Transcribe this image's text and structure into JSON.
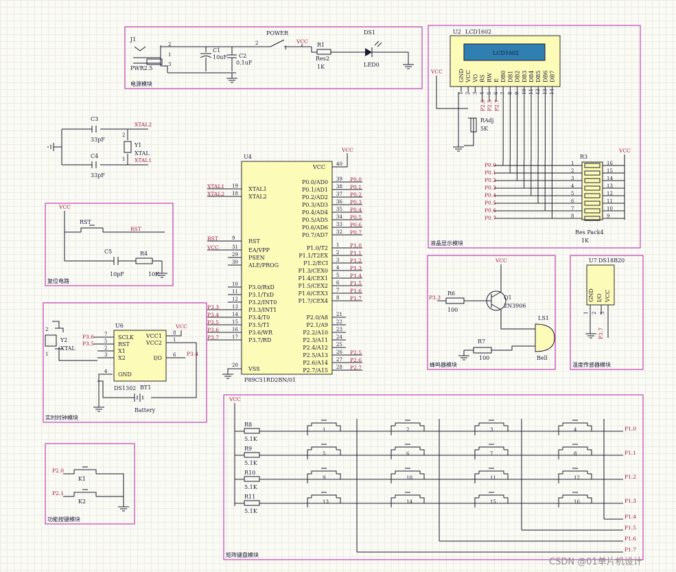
{
  "modules": {
    "power": "电源模块",
    "lcd": "液晶显示模块",
    "reset": "复位电路",
    "buzzer": "蜂鸣器模块",
    "temp": "温度传感器模块",
    "rtc": "实时时钟模块",
    "func_keys": "功能按键模块",
    "matrix_keys": "矩阵键盘模块"
  },
  "power": {
    "j1": "J1",
    "pwr": "PWR2.5",
    "c1": "C1",
    "c1v": "10uF",
    "c2": "C2",
    "c2v": "0.1uF",
    "switch": "POWER",
    "vcc": "VCC",
    "r1": "R1",
    "r1t": "Res2",
    "r1v": "1K",
    "ds1": "DS1",
    "led": "LED0",
    "p1": "1",
    "p2": "2",
    "p3": "3",
    "sw1": "1",
    "sw2": "2"
  },
  "crystal": {
    "c3": "C3",
    "c3v": "33pF",
    "c4": "C4",
    "c4v": "33pF",
    "y1": "Y1",
    "xtal": "XTAL",
    "xtal2": "XTAL2",
    "xtal1": "XTAL1",
    "p1": "1",
    "p2": "2"
  },
  "reset": {
    "vcc": "VCC",
    "rst": "RST",
    "rstnet": "RST",
    "c5": "C5",
    "c5v": "10pF",
    "r4": "R4",
    "r4v": "10K"
  },
  "mcu": {
    "ref": "U4",
    "part": "P89C51RD2BN/01",
    "vcc": "VCC",
    "vss": "VSS",
    "p40": "40",
    "p20": "20",
    "left_pins": [
      {
        "n": "19",
        "name": "XTAL1",
        "net": "XTAL1"
      },
      {
        "n": "18",
        "name": "XTAL2",
        "net": "XTAL2"
      },
      {
        "n": "9",
        "name": "RST",
        "net": "RST"
      },
      {
        "n": "31",
        "name": "EA/VPP",
        "net": "VCC"
      },
      {
        "n": "29",
        "name": "PSEN",
        "net": ""
      },
      {
        "n": "30",
        "name": "ALE/PROG",
        "net": ""
      },
      {
        "n": "10",
        "name": "P3.0/RxD",
        "net": ""
      },
      {
        "n": "11",
        "name": "P3.1/TxD",
        "net": ""
      },
      {
        "n": "12",
        "name": "P3.2/INT0",
        "net": ""
      },
      {
        "n": "13",
        "name": "P3.3/INT1",
        "net": "P3.3"
      },
      {
        "n": "14",
        "name": "P3.4/T0",
        "net": "P3.4"
      },
      {
        "n": "15",
        "name": "P3.5/T1",
        "net": "P3.5"
      },
      {
        "n": "16",
        "name": "P3.6/WR",
        "net": "P3.6"
      },
      {
        "n": "17",
        "name": "P3.7/RD",
        "net": "P3.7"
      }
    ],
    "right_pins": [
      {
        "n": "39",
        "name": "P0.0/AD0",
        "net": "P0.0"
      },
      {
        "n": "38",
        "name": "P0.1/AD1",
        "net": "P0.1"
      },
      {
        "n": "37",
        "name": "P0.2/AD2",
        "net": "P0.2"
      },
      {
        "n": "36",
        "name": "P0.3/AD3",
        "net": "P0.3"
      },
      {
        "n": "35",
        "name": "P0.4/AD4",
        "net": "P0.4"
      },
      {
        "n": "34",
        "name": "P0.5/AD5",
        "net": "P0.5"
      },
      {
        "n": "33",
        "name": "P0.6/AD6",
        "net": "P0.6"
      },
      {
        "n": "32",
        "name": "P0.7/AD7",
        "net": "P0.7"
      },
      {
        "n": "1",
        "name": "P1.0/T2",
        "net": "P1.0"
      },
      {
        "n": "2",
        "name": "P1.1/T2EX",
        "net": "P1.1"
      },
      {
        "n": "3",
        "name": "P1.2/ECI",
        "net": "P1.2"
      },
      {
        "n": "4",
        "name": "P1.3/CEX0",
        "net": "P1.3"
      },
      {
        "n": "5",
        "name": "P1.4/CEX1",
        "net": "P1.4"
      },
      {
        "n": "6",
        "name": "P1.5/CEX2",
        "net": "P1.5"
      },
      {
        "n": "7",
        "name": "P1.6/CEX3",
        "net": "P1.6"
      },
      {
        "n": "8",
        "name": "P1.7/CEX4",
        "net": "P1.7"
      },
      {
        "n": "21",
        "name": "P2.0/A8",
        "net": ""
      },
      {
        "n": "22",
        "name": "P2.1/A9",
        "net": ""
      },
      {
        "n": "23",
        "name": "P2.2/A10",
        "net": ""
      },
      {
        "n": "24",
        "name": "P2.3/A11",
        "net": ""
      },
      {
        "n": "25",
        "name": "P2.4/A12",
        "net": ""
      },
      {
        "n": "26",
        "name": "P2.5/A13",
        "net": "P2.5"
      },
      {
        "n": "27",
        "name": "P2.6/A14",
        "net": "P2.6"
      },
      {
        "n": "28",
        "name": "P2.7/A15",
        "net": "P2.7"
      }
    ]
  },
  "lcd": {
    "ref": "U2",
    "part": "LCD1602",
    "label": "LCD1602",
    "vcc": "VCC",
    "radj": "RAdj",
    "radjv": "5K",
    "pins": [
      "GND",
      "VCC",
      "VO",
      "RS",
      "RW",
      "E",
      "DB0",
      "DB1",
      "DB2",
      "DB3",
      "DB4",
      "DB5",
      "DB6",
      "DB7"
    ],
    "nums": [
      "1",
      "2",
      "3",
      "4",
      "5",
      "6",
      "7",
      "8",
      "9",
      "10",
      "11",
      "12",
      "13",
      "14"
    ],
    "ctrl": [
      "P2.6",
      "P2.5",
      "P2.7"
    ],
    "r3": "R3",
    "pack": "Res Pack4",
    "packv": "1K",
    "packvcc": "VCC",
    "nets": [
      "P0.0",
      "P0.1",
      "P0.2",
      "P0.3",
      "P0.4",
      "P0.5",
      "P0.6",
      "P0.7"
    ],
    "lnum": [
      "1",
      "2",
      "3",
      "4",
      "5",
      "6",
      "7",
      "8"
    ],
    "rnum": [
      "16",
      "15",
      "14",
      "13",
      "12",
      "11",
      "10",
      "9"
    ]
  },
  "buzzer": {
    "vcc": "VCC",
    "net": "P3.3",
    "r6": "R6",
    "r6v": "100",
    "q1": "Q1",
    "q1p": "2N3906",
    "r7": "R7",
    "r7v": "100",
    "ls1": "LS1",
    "bell": "Bell"
  },
  "temp": {
    "ref": "U7",
    "part": "DS18B20",
    "pins": [
      "GND",
      "I/O",
      "VCC"
    ],
    "nums": [
      "1",
      "2",
      "3"
    ],
    "net": "P3.7"
  },
  "rtc": {
    "ref": "U6",
    "part": "DS1302",
    "y2": "Y2",
    "xtal": "XTAL",
    "vcc": "VCC",
    "bt1": "BT1",
    "bat": "Battery",
    "io": "P3.4",
    "pins_l": [
      "SCLK",
      "RST",
      "X1",
      "X2",
      "GND"
    ],
    "pins_r": [
      "VCC1",
      "VCC2",
      "I/O"
    ],
    "nums_l": [
      "7",
      "5",
      "2",
      "3",
      "4"
    ],
    "nums_r": [
      "8",
      "1",
      "6"
    ],
    "nets": [
      "P3.6",
      "P3.5"
    ],
    "yp1": "1",
    "yp2": "2"
  },
  "func_keys": {
    "k1": "K1",
    "k2": "K2",
    "n1": "P2.0",
    "n2": "P2.1"
  },
  "matrix": {
    "vcc": "VCC",
    "rows": [
      {
        "r": "R8",
        "v": "5.1K",
        "net": "P1.0"
      },
      {
        "r": "R9",
        "v": "5.1K",
        "net": "P1.1"
      },
      {
        "r": "R10",
        "v": "5.1K",
        "net": "P1.2"
      },
      {
        "r": "R11",
        "v": "5.1K",
        "net": "P1.3"
      }
    ],
    "cols": [
      "P1.4",
      "P1.5",
      "P1.6",
      "P1.7"
    ],
    "keys": [
      "1",
      "2",
      "3",
      "4",
      "5",
      "6",
      "7",
      "8",
      "9",
      "10",
      "11",
      "12",
      "13",
      "14",
      "15",
      "16"
    ]
  },
  "watermark": "CSDN @01单片机设计"
}
